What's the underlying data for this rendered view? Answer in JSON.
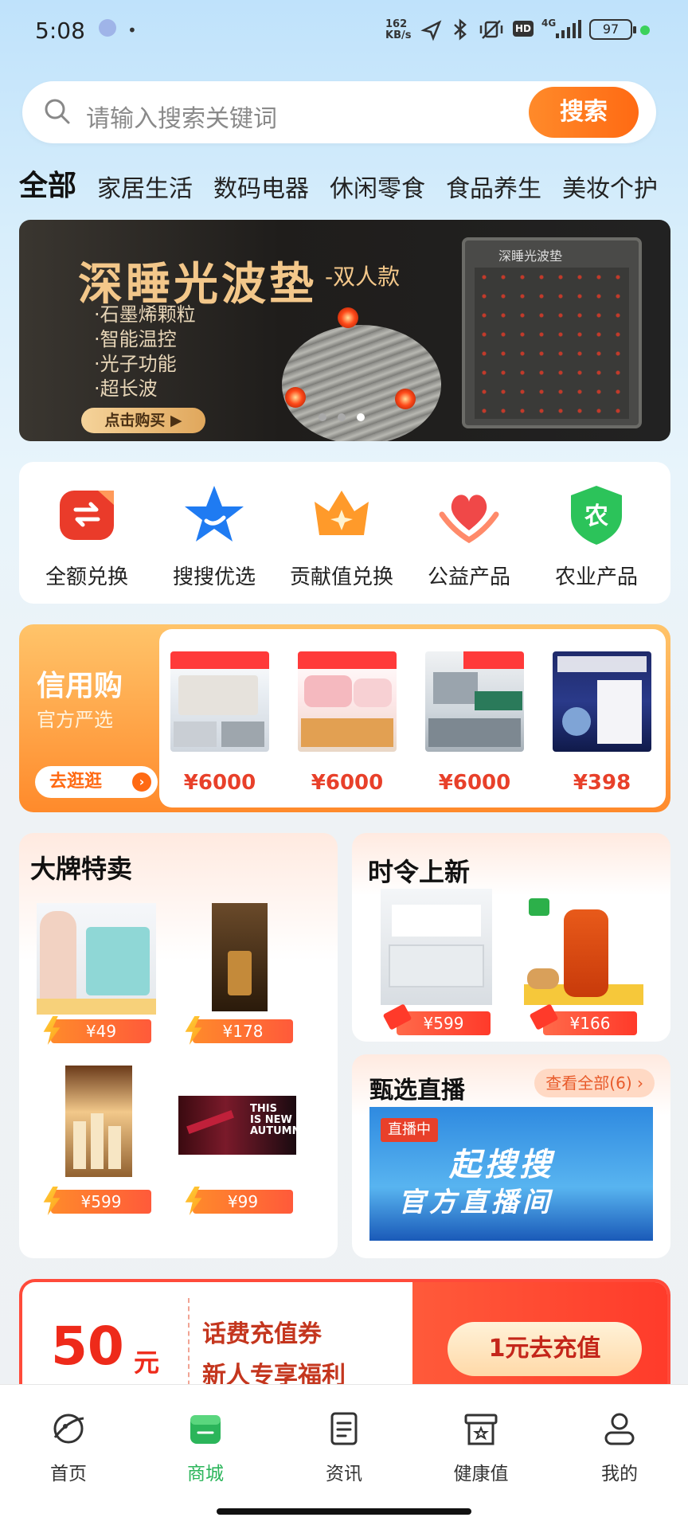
{
  "status_bar": {
    "time": "5:08",
    "net_speed": "162\nKB/s",
    "battery": "97",
    "hd": "HD",
    "signal": "4G"
  },
  "search": {
    "placeholder": "请输入搜索关键词",
    "button": "搜索"
  },
  "tabs": [
    "全部",
    "家居生活",
    "数码电器",
    "休闲零食",
    "食品养生",
    "美妆个护"
  ],
  "banner": {
    "title": "深睡光波垫",
    "subtitle": "-双人款",
    "features": [
      "·石墨烯颗粒",
      "·智能温控",
      "·光子功能",
      "·超长波"
    ],
    "buy_label": "点击购买 ▶",
    "mat_label": "深睡光波垫"
  },
  "categories": [
    {
      "label": "全额兑换",
      "icon": "exchange-icon"
    },
    {
      "label": "搜搜优选",
      "icon": "star-icon"
    },
    {
      "label": "贡献值兑换",
      "icon": "crown-icon"
    },
    {
      "label": "公益产品",
      "icon": "heart-hands-icon"
    },
    {
      "label": "农业产品",
      "icon": "agriculture-shield-icon"
    }
  ],
  "credit": {
    "title": "信用购",
    "subtitle": "官方严选",
    "go_label": "去逛逛",
    "products": [
      {
        "price": "¥6000"
      },
      {
        "price": "¥6000"
      },
      {
        "price": "¥6000"
      },
      {
        "price": "¥398"
      }
    ]
  },
  "brand_sale": {
    "title": "大牌特卖",
    "items": [
      {
        "price": "¥49"
      },
      {
        "price": "¥178"
      },
      {
        "price": "¥599"
      },
      {
        "price": "¥99"
      }
    ]
  },
  "season": {
    "title": "时令上新",
    "items": [
      {
        "price": "¥599"
      },
      {
        "price": "¥166"
      }
    ]
  },
  "live": {
    "title": "甄选直播",
    "view_all": "查看全部(6)",
    "badge": "直播中",
    "line1": "起搜搜",
    "line2": "官方直播间"
  },
  "recharge": {
    "amount": "50",
    "unit": "元",
    "line1": "话费充值券",
    "line2": "新人专享福利",
    "cta": "1元去充值"
  },
  "nav": [
    {
      "label": "首页",
      "icon": "home-planet-icon"
    },
    {
      "label": "商城",
      "icon": "store-icon",
      "active": true
    },
    {
      "label": "资讯",
      "icon": "news-icon"
    },
    {
      "label": "健康值",
      "icon": "health-box-icon"
    },
    {
      "label": "我的",
      "icon": "profile-icon"
    }
  ],
  "colors": {
    "accent": "#ff6a13",
    "price": "#e8402a",
    "nav_active": "#2bb55a"
  }
}
